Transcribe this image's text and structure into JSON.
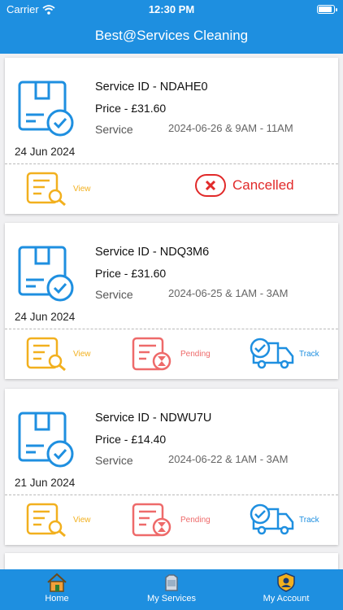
{
  "status_bar": {
    "carrier": "Carrier",
    "time": "12:30 PM"
  },
  "app_title": "Best@Services Cleaning",
  "orders": [
    {
      "service_id": "Service ID - NDAHE0",
      "price": "Price - £31.60",
      "service_label": "Service",
      "slot": "2024-06-26 & 9AM - 11AM",
      "date": "24 Jun 2024",
      "view_label": "View",
      "status": "Cancelled"
    },
    {
      "service_id": "Service ID - NDQ3M6",
      "price": "Price - £31.60",
      "service_label": "Service",
      "slot": "2024-06-25 & 1AM - 3AM",
      "date": "24 Jun 2024",
      "view_label": "View",
      "status": "Pending",
      "track_label": "Track"
    },
    {
      "service_id": "Service ID - NDWU7U",
      "price": "Price - £14.40",
      "service_label": "Service",
      "slot": "2024-06-22 & 1AM - 3AM",
      "date": "21 Jun 2024",
      "view_label": "View",
      "status": "Pending",
      "track_label": "Track"
    }
  ],
  "tabs": [
    {
      "label": "Home",
      "icon": "home-icon"
    },
    {
      "label": "My Services",
      "icon": "services-icon"
    },
    {
      "label": "My Account",
      "icon": "account-icon"
    }
  ],
  "colors": {
    "primary": "#1e8fe0",
    "view": "#f2b01e",
    "pending": "#ee6a6a",
    "cancelled": "#e12a2a"
  }
}
